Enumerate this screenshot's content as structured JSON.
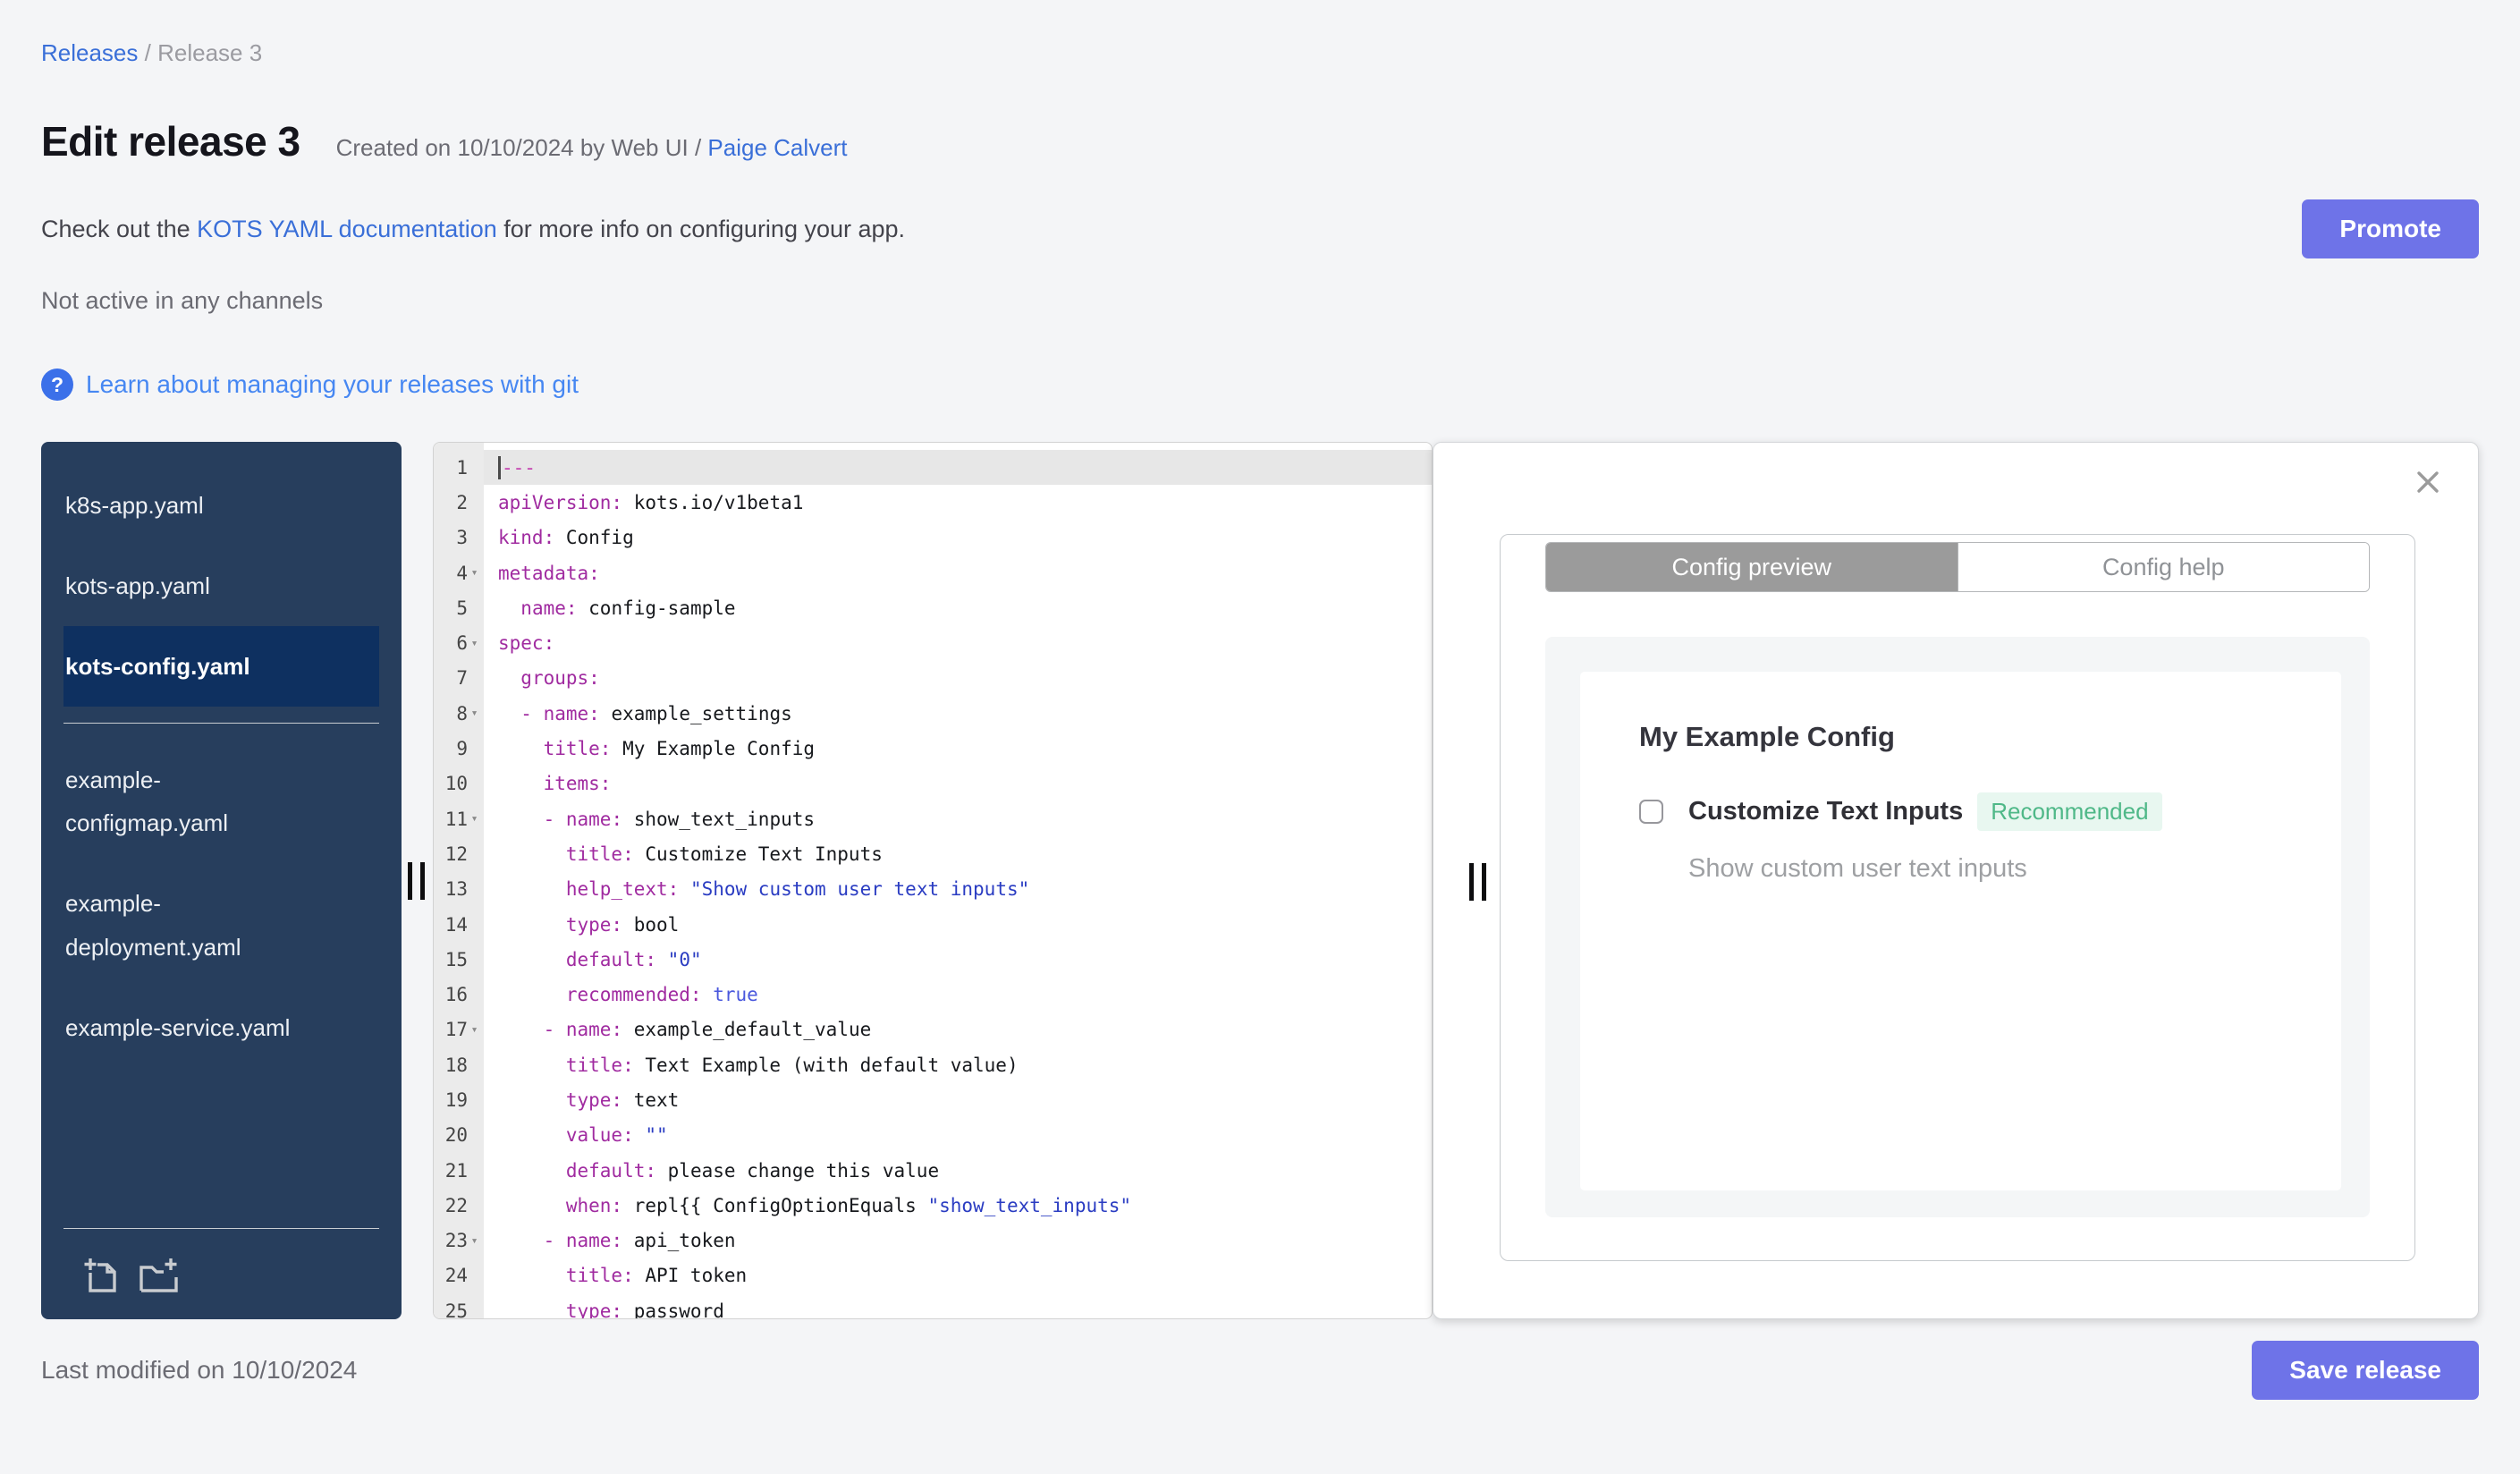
{
  "breadcrumb": {
    "parent": "Releases",
    "separator": "/",
    "current": "Release 3"
  },
  "header": {
    "title": "Edit release 3",
    "created_prefix": "Created on 10/10/2024 by Web UI / ",
    "author": "Paige Calvert"
  },
  "toolbar": {
    "promote_label": "Promote",
    "save_label": "Save release"
  },
  "docs_line": {
    "before": "Check out the ",
    "link": "KOTS YAML documentation",
    "after": " for more info on configuring your app."
  },
  "channels_status": "Not active in any channels",
  "git_help": {
    "icon": "?",
    "label": "Learn about managing your releases with git"
  },
  "sidebar": {
    "files_top": [
      {
        "label": "k8s-app.yaml",
        "active": false
      },
      {
        "label": "kots-app.yaml",
        "active": false
      },
      {
        "label": "kots-config.yaml",
        "active": true
      }
    ],
    "files_bottom": [
      {
        "label": "example-configmap.yaml",
        "active": false
      },
      {
        "label": "example-deployment.yaml",
        "active": false
      },
      {
        "label": "example-service.yaml",
        "active": false
      }
    ],
    "actions": [
      "new-file",
      "new-folder"
    ]
  },
  "editor": {
    "lines": [
      {
        "n": 1,
        "fold": false,
        "tokens": [
          [
            "doc",
            "---"
          ]
        ]
      },
      {
        "n": 2,
        "fold": false,
        "tokens": [
          [
            "key",
            "apiVersion:"
          ],
          [
            "plain",
            " kots.io/v1beta1"
          ]
        ]
      },
      {
        "n": 3,
        "fold": false,
        "tokens": [
          [
            "key",
            "kind:"
          ],
          [
            "plain",
            " Config"
          ]
        ]
      },
      {
        "n": 4,
        "fold": true,
        "tokens": [
          [
            "key",
            "metadata:"
          ]
        ]
      },
      {
        "n": 5,
        "fold": false,
        "tokens": [
          [
            "plain",
            "  "
          ],
          [
            "key",
            "name:"
          ],
          [
            "plain",
            " config-sample"
          ]
        ]
      },
      {
        "n": 6,
        "fold": true,
        "tokens": [
          [
            "key",
            "spec:"
          ]
        ]
      },
      {
        "n": 7,
        "fold": false,
        "tokens": [
          [
            "plain",
            "  "
          ],
          [
            "key",
            "groups:"
          ]
        ]
      },
      {
        "n": 8,
        "fold": true,
        "tokens": [
          [
            "plain",
            "  "
          ],
          [
            "dash",
            "- "
          ],
          [
            "key",
            "name:"
          ],
          [
            "plain",
            " example_settings"
          ]
        ]
      },
      {
        "n": 9,
        "fold": false,
        "tokens": [
          [
            "plain",
            "    "
          ],
          [
            "key",
            "title:"
          ],
          [
            "plain",
            " My Example Config"
          ]
        ]
      },
      {
        "n": 10,
        "fold": false,
        "tokens": [
          [
            "plain",
            "    "
          ],
          [
            "key",
            "items:"
          ]
        ]
      },
      {
        "n": 11,
        "fold": true,
        "tokens": [
          [
            "plain",
            "    "
          ],
          [
            "dash",
            "- "
          ],
          [
            "key",
            "name:"
          ],
          [
            "plain",
            " show_text_inputs"
          ]
        ]
      },
      {
        "n": 12,
        "fold": false,
        "tokens": [
          [
            "plain",
            "      "
          ],
          [
            "key",
            "title:"
          ],
          [
            "plain",
            " Customize Text Inputs"
          ]
        ]
      },
      {
        "n": 13,
        "fold": false,
        "tokens": [
          [
            "plain",
            "      "
          ],
          [
            "key",
            "help_text:"
          ],
          [
            "plain",
            " "
          ],
          [
            "str",
            "\"Show custom user text inputs\""
          ]
        ]
      },
      {
        "n": 14,
        "fold": false,
        "tokens": [
          [
            "plain",
            "      "
          ],
          [
            "key",
            "type:"
          ],
          [
            "plain",
            " bool"
          ]
        ]
      },
      {
        "n": 15,
        "fold": false,
        "tokens": [
          [
            "plain",
            "      "
          ],
          [
            "key",
            "default:"
          ],
          [
            "plain",
            " "
          ],
          [
            "str",
            "\"0\""
          ]
        ]
      },
      {
        "n": 16,
        "fold": false,
        "tokens": [
          [
            "plain",
            "      "
          ],
          [
            "key",
            "recommended:"
          ],
          [
            "plain",
            " "
          ],
          [
            "bool",
            "true"
          ]
        ]
      },
      {
        "n": 17,
        "fold": true,
        "tokens": [
          [
            "plain",
            "    "
          ],
          [
            "dash",
            "- "
          ],
          [
            "key",
            "name:"
          ],
          [
            "plain",
            " example_default_value"
          ]
        ]
      },
      {
        "n": 18,
        "fold": false,
        "tokens": [
          [
            "plain",
            "      "
          ],
          [
            "key",
            "title:"
          ],
          [
            "plain",
            " Text Example (with default value)"
          ]
        ]
      },
      {
        "n": 19,
        "fold": false,
        "tokens": [
          [
            "plain",
            "      "
          ],
          [
            "key",
            "type:"
          ],
          [
            "plain",
            " text"
          ]
        ]
      },
      {
        "n": 20,
        "fold": false,
        "tokens": [
          [
            "plain",
            "      "
          ],
          [
            "key",
            "value:"
          ],
          [
            "plain",
            " "
          ],
          [
            "str",
            "\"\""
          ]
        ]
      },
      {
        "n": 21,
        "fold": false,
        "tokens": [
          [
            "plain",
            "      "
          ],
          [
            "key",
            "default:"
          ],
          [
            "plain",
            " please change this value"
          ]
        ]
      },
      {
        "n": 22,
        "fold": false,
        "tokens": [
          [
            "plain",
            "      "
          ],
          [
            "key",
            "when:"
          ],
          [
            "plain",
            " repl{{ ConfigOptionEquals "
          ],
          [
            "str",
            "\"show_text_inputs\""
          ]
        ]
      },
      {
        "n": 23,
        "fold": true,
        "tokens": [
          [
            "plain",
            "    "
          ],
          [
            "dash",
            "- "
          ],
          [
            "key",
            "name:"
          ],
          [
            "plain",
            " api_token"
          ]
        ]
      },
      {
        "n": 24,
        "fold": false,
        "tokens": [
          [
            "plain",
            "      "
          ],
          [
            "key",
            "title:"
          ],
          [
            "plain",
            " API token"
          ]
        ]
      },
      {
        "n": 25,
        "fold": false,
        "tokens": [
          [
            "plain",
            "      "
          ],
          [
            "key",
            "type:"
          ],
          [
            "plain",
            " password"
          ]
        ]
      }
    ]
  },
  "panel": {
    "tabs": [
      {
        "label": "Config preview",
        "active": true
      },
      {
        "label": "Config help",
        "active": false
      }
    ],
    "card": {
      "title": "My Example Config",
      "checkbox_label": "Customize Text Inputs",
      "badge": "Recommended",
      "help": "Show custom user text inputs",
      "checked": false
    }
  },
  "footer": {
    "last_modified": "Last modified on 10/10/2024"
  },
  "colors": {
    "accent": "#6e73e8",
    "link_blue": "#3a6fd8",
    "git_link_blue": "#4687f2",
    "badge_green": "#4fb888",
    "badge_bg": "#e8f7f0",
    "sidebar_bg": "#273e5d",
    "sidebar_selected": "#0e3060",
    "tab_active_bg": "#9b9b9b"
  }
}
